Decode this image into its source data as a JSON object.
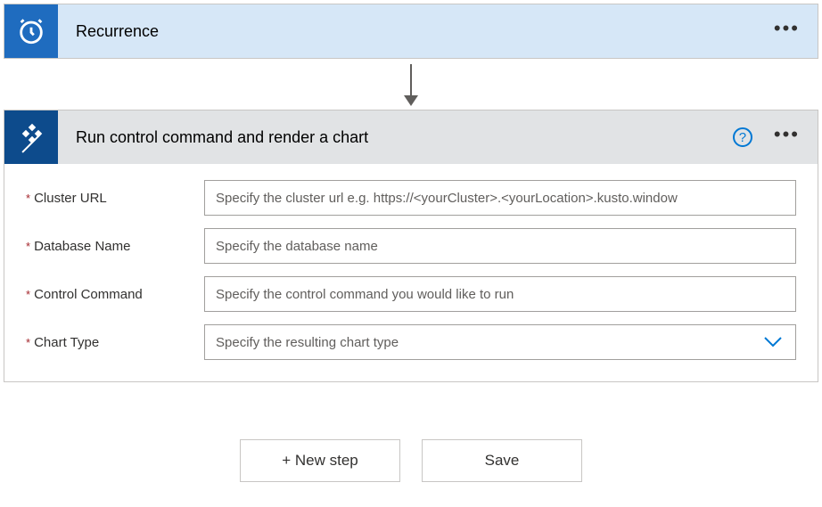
{
  "recurrence": {
    "title": "Recurrence"
  },
  "kusto": {
    "title": "Run control command and render a chart",
    "fields": {
      "cluster_url": {
        "label": "Cluster URL",
        "placeholder": "Specify the cluster url e.g. https://<yourCluster>.<yourLocation>.kusto.window"
      },
      "database_name": {
        "label": "Database Name",
        "placeholder": "Specify the database name"
      },
      "control_command": {
        "label": "Control Command",
        "placeholder": "Specify the control command you would like to run"
      },
      "chart_type": {
        "label": "Chart Type",
        "placeholder": "Specify the resulting chart type"
      }
    }
  },
  "footer": {
    "new_step": "+ New step",
    "save": "Save"
  },
  "required_mark": "*"
}
